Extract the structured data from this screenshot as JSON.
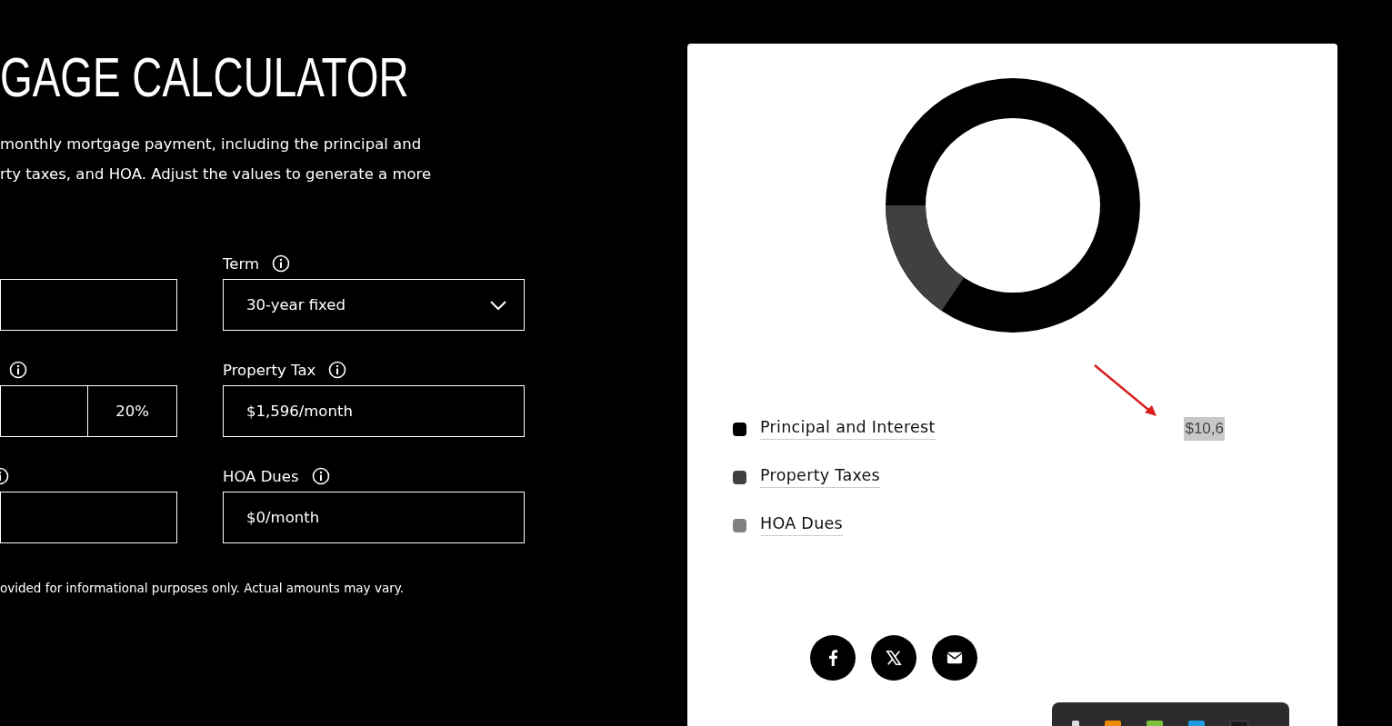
{
  "header": {
    "title": "GAGE CALCULATOR",
    "description_lines": [
      "monthly mortgage payment, including the principal and",
      "rty taxes, and HOA. Adjust the values to generate a more"
    ]
  },
  "left_fields": [
    {
      "kind": "plain",
      "has_info_icon": false
    },
    {
      "kind": "split",
      "has_info_icon": true,
      "second_value": "20%"
    },
    {
      "kind": "plain",
      "has_info_icon": true
    }
  ],
  "right_fields": [
    {
      "label": "Term",
      "kind": "select",
      "value": "30-year fixed"
    },
    {
      "label": "Property Tax",
      "kind": "text",
      "value": "$1,596/month"
    },
    {
      "label": "HOA Dues",
      "kind": "text",
      "value": "$0/month"
    }
  ],
  "disclaimer": "ovided for informational purposes only. Actual amounts may vary.",
  "breakdown": [
    {
      "label": "Principal and Interest",
      "color": "#000000",
      "value": "$10,6",
      "highlighted": true
    },
    {
      "label": "Property Taxes",
      "color": "#404040"
    },
    {
      "label": "HOA Dues",
      "color": "#808080"
    }
  ],
  "share_buttons": [
    {
      "kind": "facebook"
    },
    {
      "kind": "x"
    },
    {
      "kind": "email"
    }
  ]
}
